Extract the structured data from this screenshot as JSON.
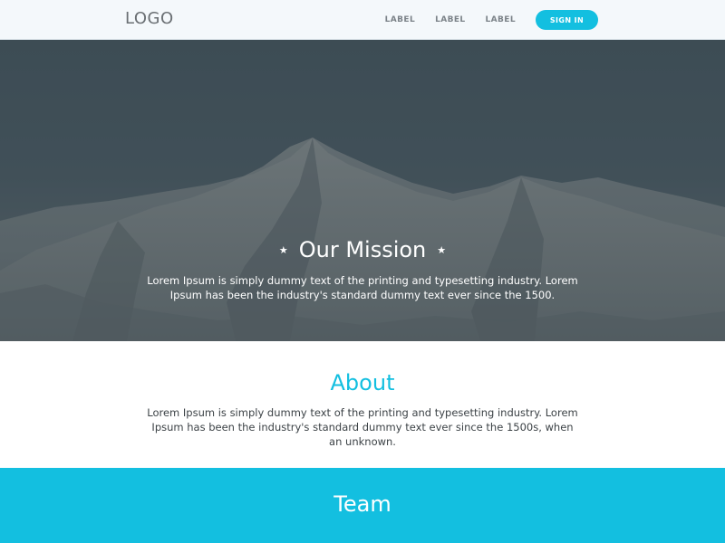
{
  "header": {
    "logo": "LOGO",
    "nav": [
      "LABEL",
      "LABEL",
      "LABEL"
    ],
    "signin_label": "SIGN IN"
  },
  "hero": {
    "title": "Our Mission",
    "star_icon": "★",
    "text": "Lorem Ipsum is simply dummy text of the printing and typesetting industry. Lorem Ipsum has been the industry's standard dummy text ever since the 1500."
  },
  "about": {
    "title": "About",
    "text": "Lorem Ipsum is simply dummy text of the printing and typesetting industry. Lorem Ipsum has been the industry's standard dummy text ever since the 1500s, when an unknown."
  },
  "team": {
    "title": "Team"
  },
  "colors": {
    "accent": "#13bfe0",
    "header_bg": "#f4f8fb",
    "hero_overlay": "#3f4d55"
  }
}
